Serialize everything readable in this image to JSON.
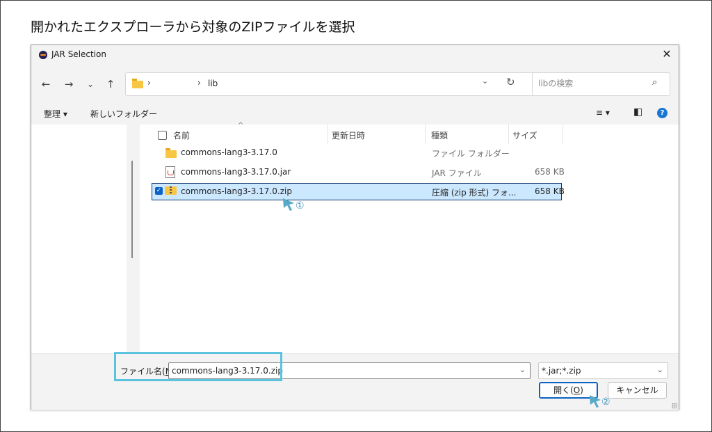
{
  "heading": "開かれたエクスプローラから対象のZIPファイルを選択",
  "window": {
    "title": "JAR Selection",
    "close": "✕"
  },
  "nav": {
    "back": "←",
    "forward": "→",
    "recent": "⌄",
    "up": "↑"
  },
  "address": {
    "sep": "›",
    "crumb": "lib",
    "dropdown": "⌄",
    "refresh": "↻"
  },
  "search": {
    "placeholder": "libの検索",
    "icon": "⌕"
  },
  "toolbar": {
    "organize": "整理 ▾",
    "new_folder": "新しいフォルダー",
    "view_icon": "≡ ▾",
    "preview_icon": "◧",
    "help_icon": "?"
  },
  "columns": {
    "name": "名前",
    "sort": "^",
    "modified": "更新日時",
    "type": "種類",
    "size": "サイズ"
  },
  "files": [
    {
      "name": "commons-lang3-3.17.0",
      "type": "ファイル フォルダー",
      "size": ""
    },
    {
      "name": "commons-lang3-3.17.0.jar",
      "type": "JAR ファイル",
      "size": "658 KB"
    },
    {
      "name": "commons-lang3-3.17.0.zip",
      "type": "圧縮 (zip 形式) フォ...",
      "size": "658 KB"
    }
  ],
  "filename": {
    "label_prefix": "ファイル名(",
    "label_key": "N",
    "label_suffix": "):",
    "value": "commons-lang3-3.17.0.zip",
    "dropdown": "⌄"
  },
  "filter": {
    "value": "*.jar;*.zip",
    "dropdown": "⌄"
  },
  "buttons": {
    "open_prefix": "開く(",
    "open_key": "O",
    "open_suffix": ")",
    "cancel": "キャンセル"
  },
  "annotations": {
    "step1": "①",
    "step2": "②"
  },
  "colors": {
    "highlight": "#5bc3de",
    "pointer": "#56a9c7",
    "selection": "#cce8ff",
    "accent": "#0b62c4",
    "folder": "#f8c643"
  }
}
